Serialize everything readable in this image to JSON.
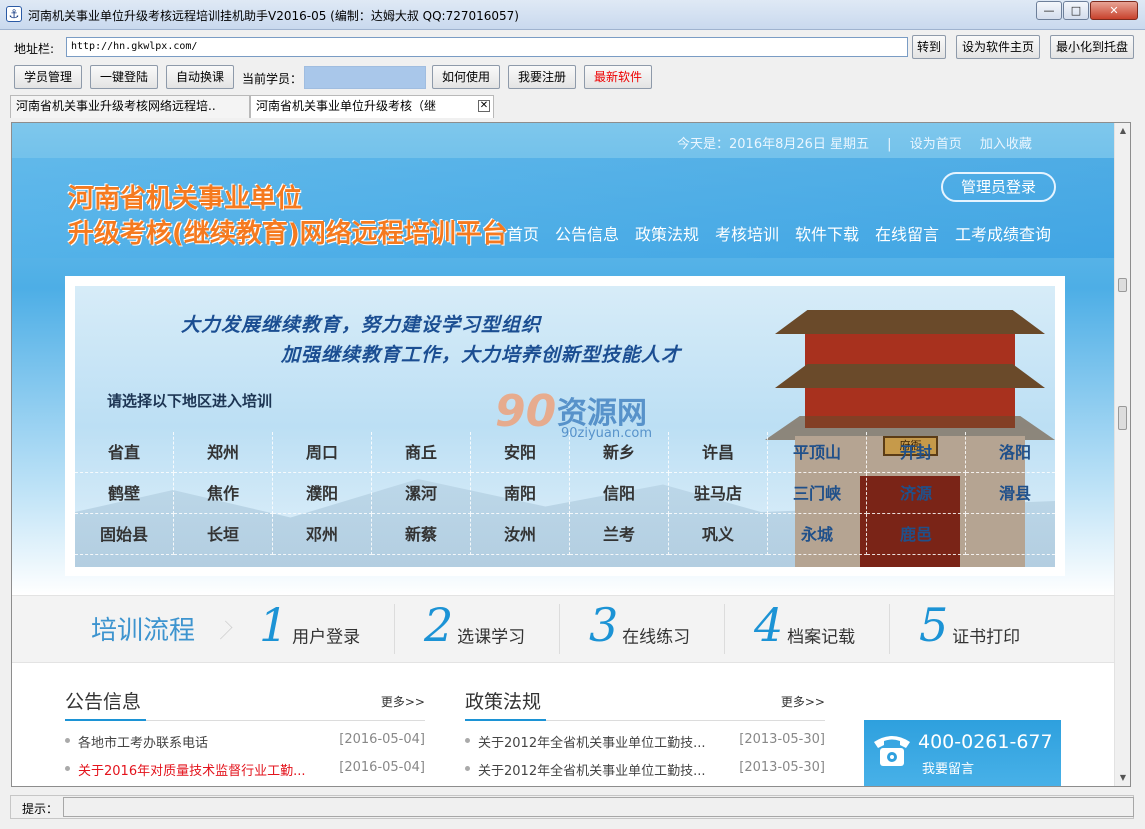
{
  "window": {
    "title": "河南机关事业单位升级考核远程培训挂机助手V2016-05 (编制：达姆大叔 QQ:727016057)",
    "app_icon": "anchor-icon",
    "min_glyph": "—",
    "max_glyph": "□",
    "close_glyph": "✕"
  },
  "address_bar": {
    "label": "地址栏:",
    "url": "http://hn.gkwlpx.com/",
    "go_button": "转到",
    "set_home_button": "设为软件主页",
    "minimize_tray_button": "最小化到托盘"
  },
  "toolbar": {
    "student_mgmt": "学员管理",
    "one_click_login": "一键登陆",
    "auto_switch": "自动换课",
    "current_student_label": "当前学员：",
    "current_student_value": "",
    "how_to_use": "如何使用",
    "register": "我要注册",
    "latest_software": "最新软件"
  },
  "tabs": [
    {
      "label": "河南省机关事业升级考核网络远程培.."
    },
    {
      "label": "河南省机关事业单位升级考核（继"
    }
  ],
  "site": {
    "today": "今天是：2016年8月26日 星期五",
    "divider": "|",
    "set_home": "设为首页",
    "add_favorite": "加入收藏",
    "title_line1": "河南省机关事业单位",
    "title_line2": "升级考核(继续教育)网络远程培训平台",
    "admin_login": "管理员登录",
    "nav": [
      "首页",
      "公告信息",
      "政策法规",
      "考核培训",
      "软件下载",
      "在线留言",
      "工考成绩查询"
    ]
  },
  "banner": {
    "slogan1": "大力发展继续教育，努力建设学习型组织",
    "slogan2": "加强继续教育工作，大力培养创新型技能人才",
    "choose_region": "请选择以下地区进入培训",
    "watermark_num": "90",
    "watermark_text": "资源网",
    "watermark_url": "90ziyuan.com",
    "plaque": "府衙",
    "regions": [
      [
        "省直",
        "郑州",
        "周口",
        "商丘",
        "安阳",
        "新乡",
        "许昌",
        "平顶山",
        "开封",
        "洛阳"
      ],
      [
        "鹤壁",
        "焦作",
        "濮阳",
        "漯河",
        "南阳",
        "信阳",
        "驻马店",
        "三门峡",
        "济源",
        "滑县"
      ],
      [
        "固始县",
        "长垣",
        "邓州",
        "新蔡",
        "汝州",
        "兰考",
        "巩义",
        "永城",
        "鹿邑",
        ""
      ]
    ]
  },
  "process": {
    "title": "培训流程",
    "steps": [
      {
        "num": "1",
        "label": "用户登录"
      },
      {
        "num": "2",
        "label": "选课学习"
      },
      {
        "num": "3",
        "label": "在线练习"
      },
      {
        "num": "4",
        "label": "档案记载"
      },
      {
        "num": "5",
        "label": "证书打印"
      }
    ]
  },
  "announcements": {
    "title": "公告信息",
    "more": "更多>>",
    "items": [
      {
        "text": "各地市工考办联系电话",
        "date": "[2016-05-04]",
        "highlight": false
      },
      {
        "text": "关于2016年对质量技术监督行业工勤...",
        "date": "[2016-05-04]",
        "highlight": true
      }
    ]
  },
  "policies": {
    "title": "政策法规",
    "more": "更多>>",
    "items": [
      {
        "text": "关于2012年全省机关事业单位工勤技...",
        "date": "[2013-05-30]"
      },
      {
        "text": "关于2012年全省机关事业单位工勤技...",
        "date": "[2013-05-30]"
      }
    ]
  },
  "hotline": {
    "number": "400-0261-677",
    "label": "我要留言"
  },
  "statusbar": {
    "label": "提示：",
    "value": ""
  },
  "colors": {
    "accent_blue": "#1c93d5",
    "title_orange": "#f57a1f",
    "highlight_red": "#e3131c"
  }
}
